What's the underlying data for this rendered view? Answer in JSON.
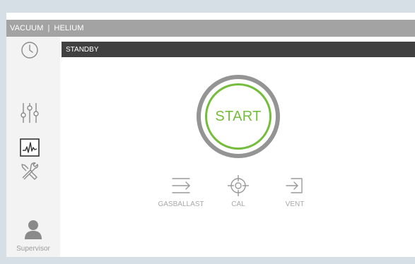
{
  "header": {
    "vacuum_label": "VACUUM",
    "separator": "|",
    "helium_label": "HELIUM"
  },
  "sidebar": {
    "items": [
      {
        "icon": "clock-icon"
      },
      {
        "icon": "sliders-icon"
      },
      {
        "icon": "chart-icon"
      },
      {
        "icon": "tools-icon"
      }
    ],
    "user": {
      "icon": "user-icon",
      "label": "Supervisor"
    }
  },
  "status": {
    "text": "STANDBY"
  },
  "start": {
    "label": "START"
  },
  "actions": [
    {
      "icon": "gasballast-icon",
      "label": "GASBALLAST"
    },
    {
      "icon": "crosshair-icon",
      "label": "CAL"
    },
    {
      "icon": "vent-icon",
      "label": "VENT"
    }
  ],
  "colors": {
    "accent_green": "#74bd3c",
    "ring_gray": "#949494",
    "topbar_gray": "#a3a3a3",
    "status_dark": "#404040",
    "sidebar_bg": "#f3f3f3",
    "page_bg": "#d6dfe6"
  }
}
